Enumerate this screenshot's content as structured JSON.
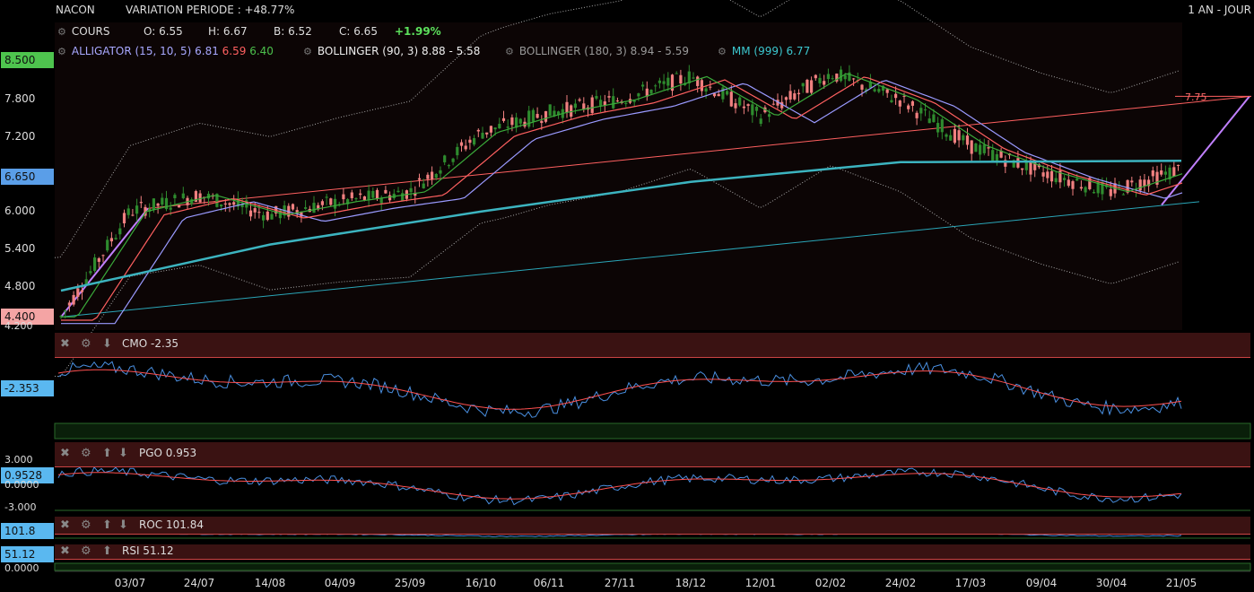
{
  "header": {
    "symbol": "NACON",
    "variation": "VARIATION PERIODE : +48.77%",
    "period": "1 AN - JOUR"
  },
  "quote": {
    "cours_label": "COURS",
    "open": "O: 6.55",
    "high": "H: 6.67",
    "low": "B: 6.52",
    "close": "C: 6.65",
    "change": "+1.99%"
  },
  "indicators": {
    "alligator_label": "ALLIGATOR (15, 10, 5)",
    "alligator_v1": "6.81",
    "alligator_v2": "6.59",
    "alligator_v3": "6.40",
    "bollinger90": "BOLLINGER (90, 3)  8.88 - 5.58",
    "bollinger180": "BOLLINGER (180, 3)  8.94 - 5.59",
    "mm999": "MM (999)  6.77"
  },
  "price_axis": {
    "ticks": [
      "8.500",
      "7.800",
      "7.200",
      "6.650",
      "6.000",
      "5.400",
      "4.800",
      "4.400",
      "4.200"
    ],
    "current": "6.650",
    "high_tag": "8.500",
    "low_tag": "4.400",
    "trend_target": "7.75"
  },
  "x_axis": {
    "labels": [
      "03/07",
      "24/07",
      "14/08",
      "04/09",
      "25/09",
      "16/10",
      "06/11",
      "27/11",
      "18/12",
      "12/01",
      "02/02",
      "24/02",
      "17/03",
      "09/04",
      "30/04",
      "21/05"
    ]
  },
  "panels": {
    "cmo": {
      "title": "CMO -2.35",
      "value": "-2.353"
    },
    "pgo": {
      "title": "PGO 0.953",
      "value": "0.9528",
      "ticks": [
        "3.000",
        "0.0000",
        "-3.000"
      ]
    },
    "roc": {
      "title": "ROC 101.84",
      "value": "101.8"
    },
    "rsi": {
      "title": "RSI 51.12",
      "value": "51.12",
      "ticks": [
        "0.0000"
      ]
    }
  },
  "colors": {
    "up": "#2e8b2e",
    "down": "#f08080",
    "mm999": "#3cb4c0",
    "alligator_jaw": "#9a9aff",
    "alligator_teeth": "#ff6060",
    "alligator_lips": "#3aaa3a",
    "trendline": "#c080ff"
  },
  "chart_data": {
    "type": "candlestick",
    "y_range": [
      4.2,
      8.6
    ],
    "x_range": [
      "03/07",
      "21/05"
    ],
    "close_path": [
      {
        "x": "start",
        "y": 4.4
      },
      {
        "x": "03/07",
        "y": 6.0
      },
      {
        "x": "24/07",
        "y": 6.25
      },
      {
        "x": "14/08",
        "y": 5.95
      },
      {
        "x": "04/09",
        "y": 6.15
      },
      {
        "x": "25/09",
        "y": 6.3
      },
      {
        "x": "16/10",
        "y": 7.2
      },
      {
        "x": "06/11",
        "y": 7.5
      },
      {
        "x": "27/11",
        "y": 7.7
      },
      {
        "x": "18/12",
        "y": 8.05
      },
      {
        "x": "12/01",
        "y": 7.45
      },
      {
        "x": "02/02",
        "y": 8.1
      },
      {
        "x": "24/02",
        "y": 7.7
      },
      {
        "x": "17/03",
        "y": 7.0
      },
      {
        "x": "09/04",
        "y": 6.6
      },
      {
        "x": "30/04",
        "y": 6.3
      },
      {
        "x": "21/05",
        "y": 6.65
      }
    ],
    "mm999_path": [
      {
        "x": "start",
        "y": 4.8
      },
      {
        "x": "14/08",
        "y": 5.5
      },
      {
        "x": "16/10",
        "y": 6.0
      },
      {
        "x": "18/12",
        "y": 6.45
      },
      {
        "x": "24/02",
        "y": 6.75
      },
      {
        "x": "21/05",
        "y": 6.77
      }
    ]
  }
}
